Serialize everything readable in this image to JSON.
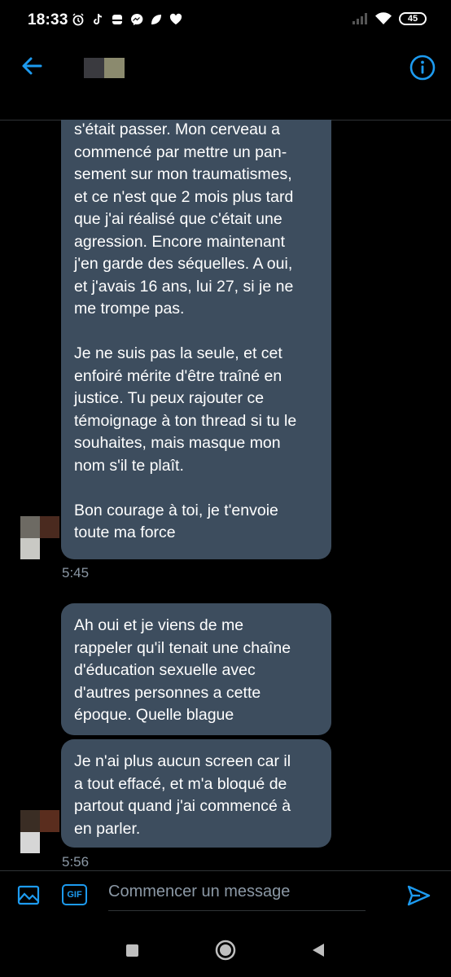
{
  "status_bar": {
    "time": "18:33",
    "battery": "45",
    "notification_icons": [
      "alarm-icon",
      "tiktok-icon",
      "app-icon",
      "messenger-icon",
      "leaf-icon",
      "heart-icon"
    ]
  },
  "header": {
    "back_icon": "arrow-left-icon",
    "info_icon": "info-icon",
    "accent_color": "#1d9bf0"
  },
  "messages": [
    {
      "text": "s'était passer. Mon cerveau a\ncommencé par mettre un pan-\nsement sur mon traumatismes,\net ce n'est que 2 mois plus tard\nque j'ai réalisé que c'était une\nagression. Encore maintenant\nj'en garde des séquelles. A oui,\net j'avais 16 ans, lui 27, si je ne\nme trompe pas.\n\nJe ne suis pas la seule, et cet\nenfoiré mérite d'être traîné en\njustice. Tu peux rajouter ce\ntémoignage à ton thread si tu le\nsouhaites, mais masque mon\nnom s'il te plaît.\n\nBon courage à toi, je t'envoie\ntoute ma force",
      "time": "5:45"
    },
    {
      "text": "Ah oui et je viens de me\nrappeler qu'il tenait une chaîne\nd'éducation sexuelle avec\nd'autres personnes a cette\népoque. Quelle blague"
    },
    {
      "text": "Je n'ai plus aucun screen car il\na tout effacé, et m'a bloqué de\npartout quand j'ai commencé à\nen parler.",
      "time": "5:56"
    }
  ],
  "composer": {
    "gif_label": "GIF",
    "placeholder": "Commencer un message",
    "image_icon": "image-icon",
    "send_icon": "send-icon"
  },
  "colors": {
    "bubble": "#3d4d5e",
    "background": "#000000",
    "secondary_text": "#8b98a5"
  }
}
